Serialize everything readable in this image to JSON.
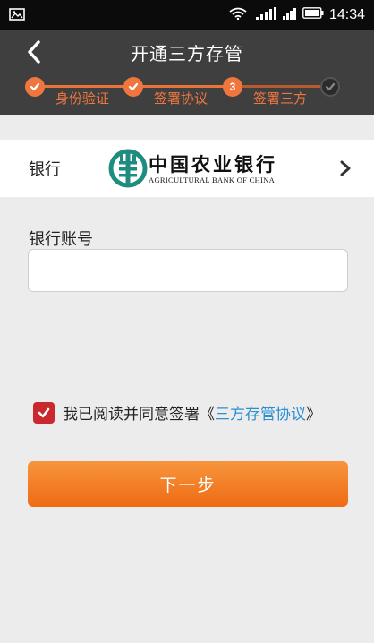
{
  "status_bar": {
    "time": "14:34",
    "icons": [
      "image-icon",
      "wifi-icon",
      "signal-icon",
      "battery-icon"
    ]
  },
  "header": {
    "title": "开通三方存管",
    "back_icon": "chevron-left-icon"
  },
  "steps": [
    {
      "label": "身份验证",
      "state": "done"
    },
    {
      "label": "签署协议",
      "state": "done"
    },
    {
      "label": "签署三方",
      "state": "current",
      "number": "3"
    },
    {
      "label": "",
      "state": "pending"
    }
  ],
  "bank": {
    "label": "银行",
    "name_cn": "中国农业银行",
    "name_en": "AGRICULTURAL BANK OF CHINA"
  },
  "account": {
    "label": "银行账号",
    "value": "",
    "placeholder": ""
  },
  "agreement": {
    "checked": true,
    "text": "我已阅读并同意签署《",
    "link": "三方存管协议",
    "close": "》"
  },
  "next_button": "下一步",
  "colors": {
    "accent": "#f07640",
    "header": "#3f3f3f",
    "link": "#2a8fd1",
    "checkbox": "#c8282e"
  }
}
